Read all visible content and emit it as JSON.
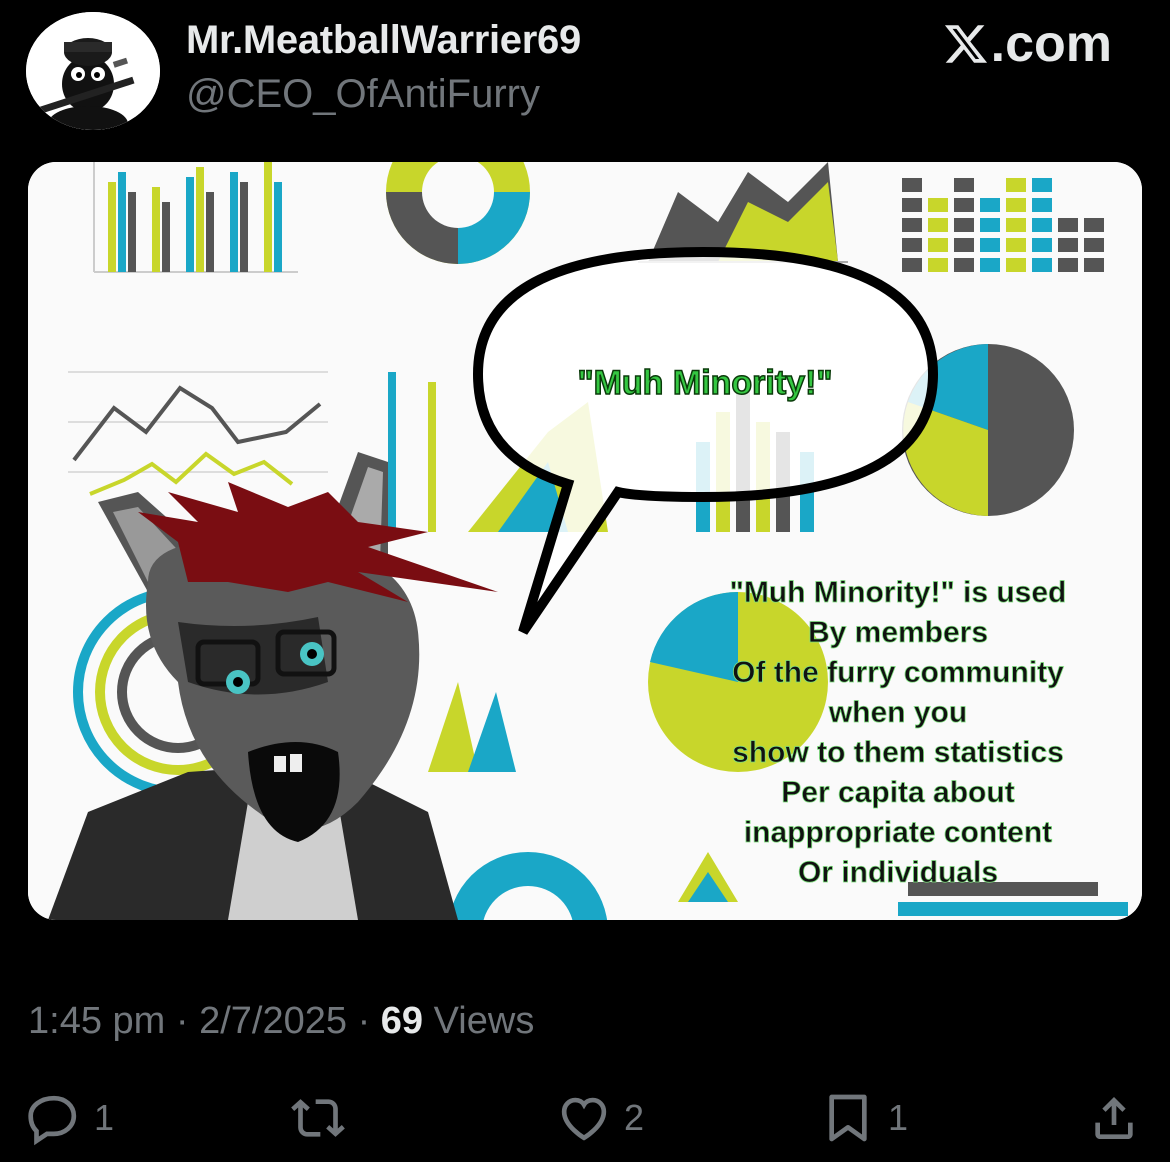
{
  "post": {
    "author": {
      "display_name": "Mr.MeatballWarrier69",
      "handle": "@CEO_OfAntiFurry",
      "avatar_icon": "cartoon-soldier-avatar"
    },
    "site_label": ".com",
    "timestamp": "1:45 pm",
    "date": "2/7/2025",
    "separator": "·",
    "views_count": "69",
    "views_label": "Views"
  },
  "media": {
    "speech_bubble_text": "\"Muh Minority!\"",
    "caption_lines": [
      "\"Muh Minority!\" is used",
      "By members",
      "Of the furry community",
      "when you",
      "show to them statistics",
      "Per capita about",
      "inappropriate content",
      "Or individuals"
    ],
    "colors": {
      "lime": "#c8d62b",
      "teal": "#1aa7c7",
      "gray": "#555555",
      "red": "#7a0d12",
      "green_text": "#35c742"
    }
  },
  "actions": {
    "reply": {
      "icon": "reply-icon",
      "count": "1"
    },
    "repost": {
      "icon": "repost-icon",
      "count": ""
    },
    "like": {
      "icon": "heart-icon",
      "count": "2"
    },
    "bookmark": {
      "icon": "bookmark-icon",
      "count": "1"
    },
    "share": {
      "icon": "share-icon",
      "count": ""
    }
  }
}
